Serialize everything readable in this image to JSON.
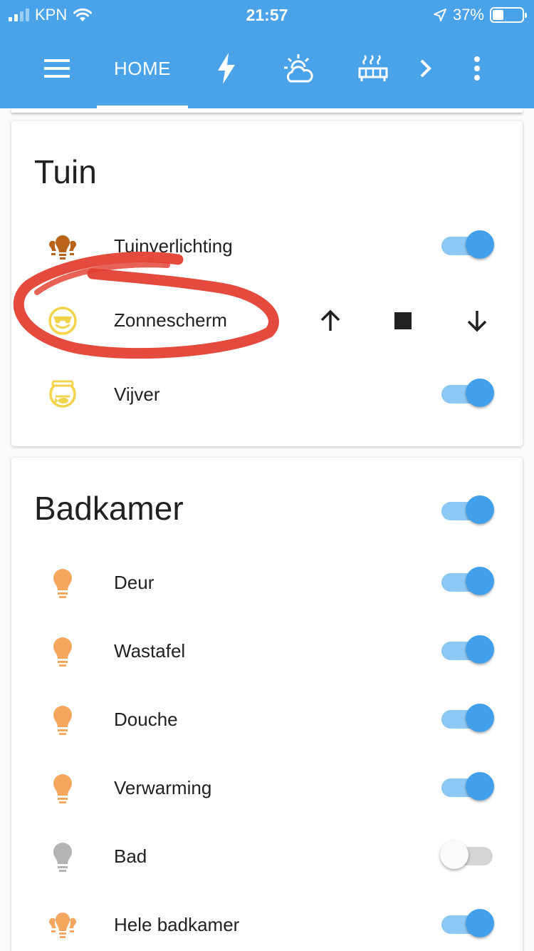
{
  "status_bar": {
    "carrier": "KPN",
    "time": "21:57",
    "battery": "37%",
    "battery_level": 0.37
  },
  "toolbar": {
    "active_tab": "HOME",
    "icons": [
      "menu-icon",
      "flash-icon",
      "weather-partly-cloudy-icon",
      "radiator-icon",
      "chevron-right-icon",
      "more-vertical-icon"
    ]
  },
  "cards": {
    "tuin": {
      "title": "Tuin",
      "rows": [
        {
          "label": "Tuinverlichting",
          "icon": "garden-lights-icon",
          "control": "toggle",
          "on": true
        },
        {
          "label": "Zonnescherm",
          "icon": "sunglasses-face-icon",
          "control": "cover"
        },
        {
          "label": "Vijver",
          "icon": "fishbowl-icon",
          "control": "toggle",
          "on": true
        }
      ]
    },
    "badkamer": {
      "title": "Badkamer",
      "header_toggle_on": true,
      "rows": [
        {
          "label": "Deur",
          "icon": "lightbulb-icon",
          "on": true
        },
        {
          "label": "Wastafel",
          "icon": "lightbulb-icon",
          "on": true
        },
        {
          "label": "Douche",
          "icon": "lightbulb-icon",
          "on": true
        },
        {
          "label": "Verwarming",
          "icon": "lightbulb-icon",
          "on": true
        },
        {
          "label": "Bad",
          "icon": "lightbulb-icon",
          "on": false
        },
        {
          "label": "Hele badkamer",
          "icon": "lightbulb-group-icon",
          "on": true
        }
      ]
    }
  },
  "colors": {
    "header": "#4aa3e9",
    "toggle_on": "#42a0ea",
    "bulb_on": "#f4a55e",
    "bulb_off": "#b3b3b3",
    "garden_icon": "#b8621b",
    "face_icon": "#f2d44a",
    "annotation": "#e23b2e"
  }
}
